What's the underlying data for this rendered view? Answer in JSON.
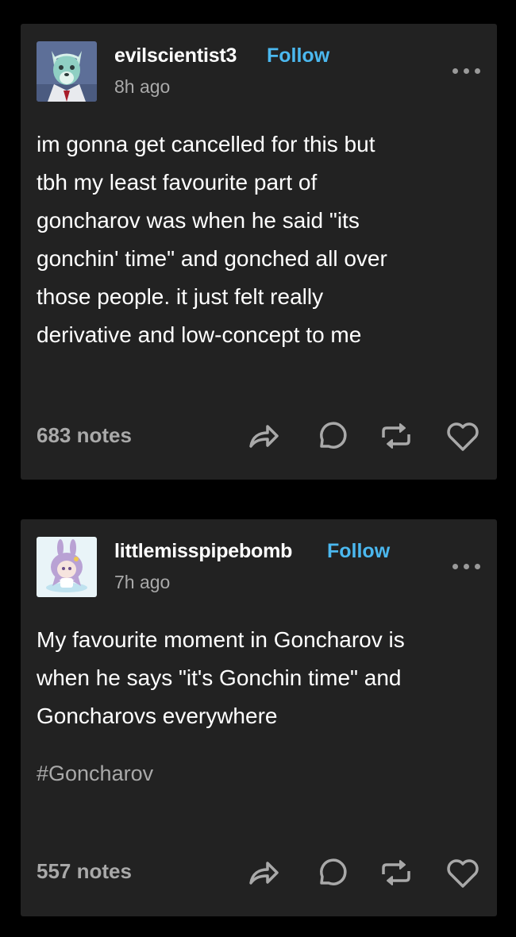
{
  "posts": [
    {
      "username": "evilscientist3",
      "follow_label": "Follow",
      "time": "8h ago",
      "body_lines": [
        "im gonna get cancelled for this but",
        "tbh my least favourite part of",
        "goncharov was when he said \"its",
        "gonchin' time\" and gonched all over",
        "those people. it just felt really",
        "derivative and low-concept to me"
      ],
      "notes": "683 notes",
      "avatar_icon": "wolf-avatar",
      "actions": [
        "share-icon",
        "reply-icon",
        "reblog-icon",
        "like-icon"
      ]
    },
    {
      "username": "littlemisspipebomb",
      "follow_label": "Follow",
      "time": "7h ago",
      "body_lines": [
        "My favourite moment in Goncharov is",
        "when he says \"it's Gonchin time\" and",
        "Goncharovs everywhere"
      ],
      "tag": "#Goncharov",
      "notes": "557 notes",
      "avatar_icon": "bunny-girl-avatar",
      "actions": [
        "share-icon",
        "reply-icon",
        "reblog-icon",
        "like-icon"
      ]
    }
  ],
  "colors": {
    "background": "#000000",
    "card": "#222222",
    "follow": "#4bb8ef",
    "muted": "#a9a9a9"
  }
}
